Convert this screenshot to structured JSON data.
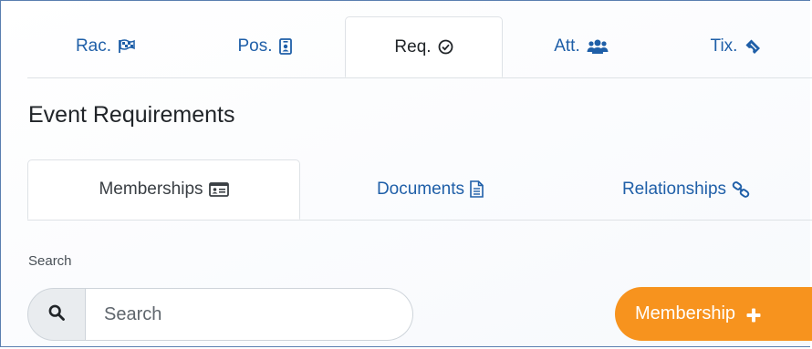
{
  "top_tabs": [
    {
      "label": "Rac.",
      "icon": "flag-checkered-icon"
    },
    {
      "label": "Pos.",
      "icon": "id-badge-icon"
    },
    {
      "label": "Req.",
      "icon": "check-circle-icon",
      "active": true
    },
    {
      "label": "Att.",
      "icon": "users-icon"
    },
    {
      "label": "Tix.",
      "icon": "ticket-icon"
    }
  ],
  "section_title": "Event Requirements",
  "sub_tabs": [
    {
      "label": "Memberships",
      "icon": "id-card-icon",
      "active": true
    },
    {
      "label": "Documents",
      "icon": "file-text-icon"
    },
    {
      "label": "Relationships",
      "icon": "link-icon"
    }
  ],
  "search": {
    "label": "Search",
    "placeholder": "Search",
    "value": ""
  },
  "add_button": {
    "label": "Membership",
    "icon": "plus-icon"
  },
  "colors": {
    "link": "#1f5fa8",
    "accent": "#f7931e",
    "border": "#dee2e6"
  }
}
